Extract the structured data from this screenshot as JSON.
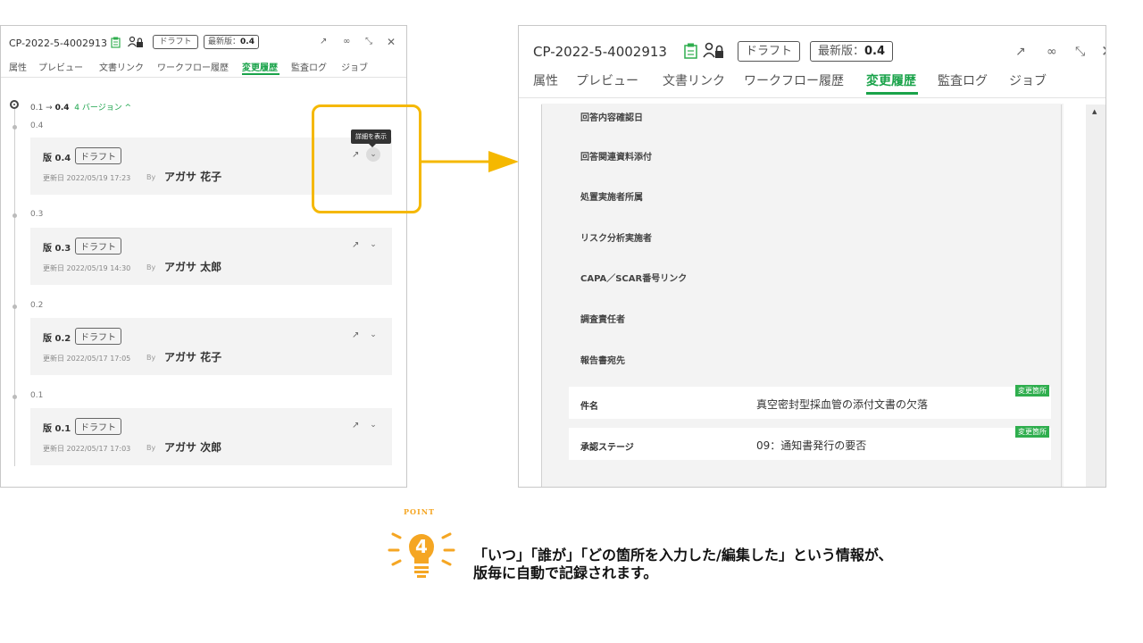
{
  "header": {
    "doc_id": "CP-2022-5-4002913",
    "status_tag": "ドラフト",
    "latest_label": "最新版：",
    "latest_value": "0.4",
    "icons": [
      "clipboard-icon",
      "user-lock-icon",
      "external-link-icon",
      "link-icon",
      "expand-icon",
      "close-icon"
    ]
  },
  "tabs": [
    "属性",
    "プレビュー",
    "文書リンク",
    "ワークフロー履歴",
    "変更履歴",
    "監査ログ",
    "ジョブ"
  ],
  "active_tab": "変更履歴",
  "history": {
    "range_from": "0.1 →",
    "range_to": "0.4",
    "range_count": "4 バージョン ^",
    "tooltip": "詳細を表示",
    "versions": [
      {
        "label": "0.4",
        "ver": "版 0.4",
        "badge": "ドラフト",
        "updated": "更新日 2022/05/19 17:23",
        "by": "By",
        "author": "アガサ 花子"
      },
      {
        "label": "0.3",
        "ver": "版 0.3",
        "badge": "ドラフト",
        "updated": "更新日 2022/05/19 14:30",
        "by": "By",
        "author": "アガサ 太郎"
      },
      {
        "label": "0.2",
        "ver": "版 0.2",
        "badge": "ドラフト",
        "updated": "更新日 2022/05/17 17:05",
        "by": "By",
        "author": "アガサ 花子"
      },
      {
        "label": "0.1",
        "ver": "版 0.1",
        "badge": "ドラフト",
        "updated": "更新日 2022/05/17 17:03",
        "by": "By",
        "author": "アガサ 次郎"
      }
    ]
  },
  "detail": {
    "fields": [
      "回答内容確認日",
      "回答関連資料添付",
      "処置実施者所属",
      "リスク分析実施者",
      "CAPA／SCAR番号リンク",
      "調査責任者",
      "報告書宛先"
    ],
    "changed_rows": [
      {
        "label": "件名",
        "value": "真空密封型採血管の添付文書の欠落",
        "flag": "変更箇所"
      },
      {
        "label": "承認ステージ",
        "value": "09：通知書発行の要否",
        "flag": "変更箇所"
      }
    ]
  },
  "point": {
    "badge_word": "POINT",
    "number": "4",
    "line1": "「いつ」「誰が」「どの箇所を入力した/編集した」という情報が、",
    "line2": "版毎に自動で記録されます。"
  },
  "colors": {
    "accent_green": "#1aa34a",
    "highlight": "#f5b800",
    "change_flag": "#2fae4e"
  }
}
